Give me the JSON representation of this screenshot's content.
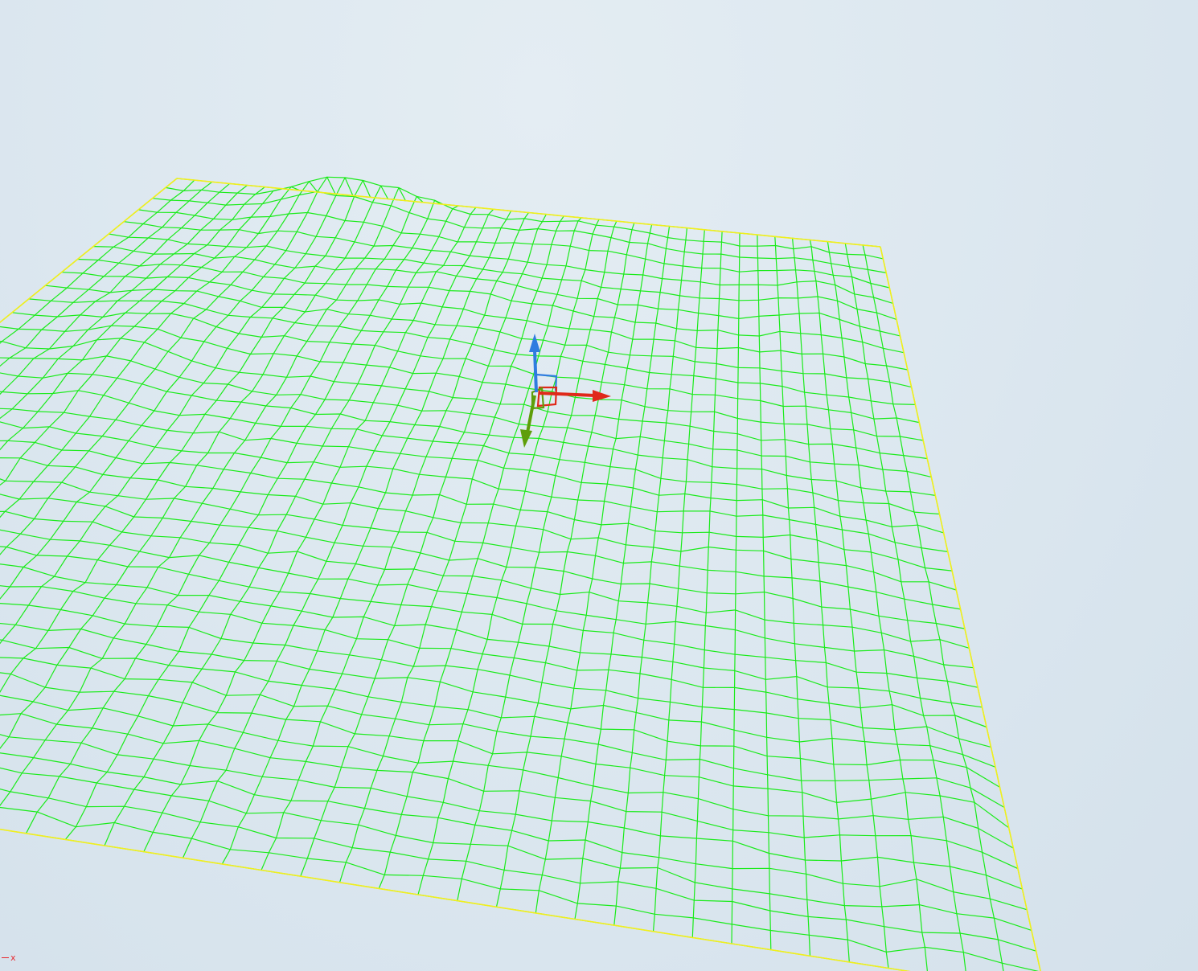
{
  "viewport": {
    "type": "3d-wireframe-terrain",
    "background_color": "#dde8f0",
    "wireframe_color": "#1aeb1a",
    "border_color": "#f2ef1c"
  },
  "gizmo": {
    "x_axis_color": "#e0291a",
    "y_axis_color": "#5e9e0a",
    "z_axis_color": "#2f7ce0"
  },
  "axis_indicator": {
    "label": "x",
    "color": "#e8262d"
  }
}
